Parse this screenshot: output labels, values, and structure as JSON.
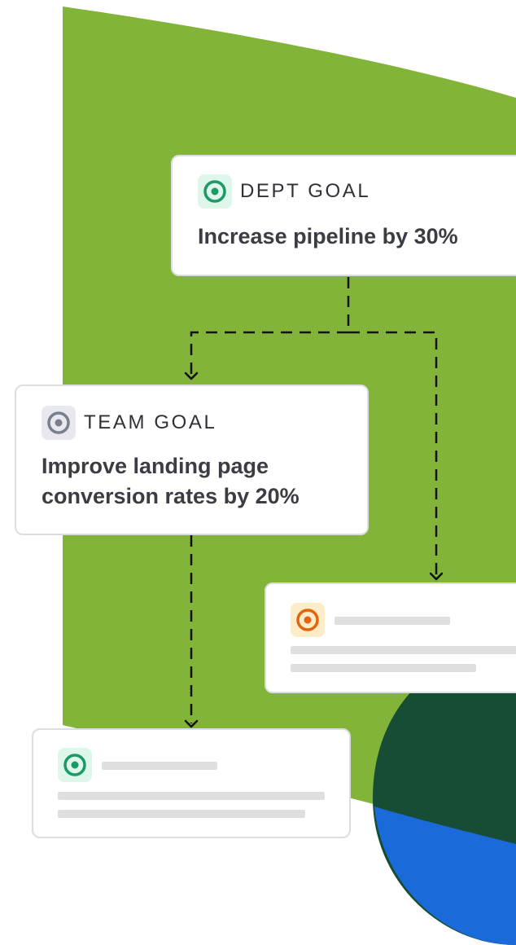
{
  "colors": {
    "green_shape": "#82b43a",
    "dark_green": "#174d35",
    "blue": "#1a6ad9",
    "card_border": "#dcdde0",
    "connector": "#111111",
    "dept_icon": "#1a9a64",
    "dept_icon_bg": "#dff6ea",
    "team_icon": "#7a7f8d",
    "team_icon_bg": "#e8e9ee",
    "orange_icon": "#e3640e",
    "orange_icon_bg": "#fdecc8",
    "placeholder": "#dedfe1"
  },
  "dept_goal": {
    "label": "DEPT GOAL",
    "title": "Increase pipeline by 30%",
    "icon": "target-icon"
  },
  "team_goal": {
    "label": "TEAM GOAL",
    "title_lines": [
      "Improve landing page",
      "conversion rates by 20%"
    ],
    "icon": "target-icon"
  },
  "placeholder_goals": [
    {
      "icon": "target-icon",
      "color": "orange"
    },
    {
      "icon": "target-icon",
      "color": "green"
    }
  ]
}
